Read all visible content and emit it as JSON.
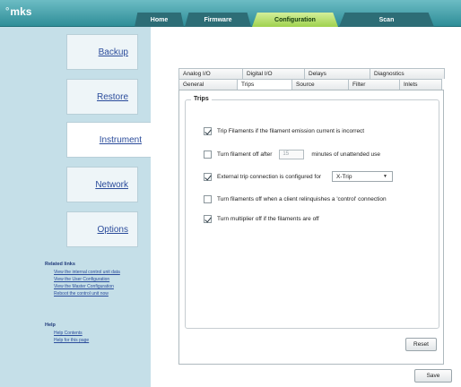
{
  "app": {
    "logo_text": "mks",
    "logo_mark": "°"
  },
  "topnav": {
    "tabs": [
      {
        "label": "Home"
      },
      {
        "label": "Firmware"
      },
      {
        "label": "Configuration"
      },
      {
        "label": "Scan"
      }
    ]
  },
  "sidebar": {
    "items": [
      {
        "label": "Backup"
      },
      {
        "label": "Restore"
      },
      {
        "label": "Instrument"
      },
      {
        "label": "Network"
      },
      {
        "label": "Options"
      }
    ],
    "related_title": "Related links",
    "related_links": [
      "View the internal control unit data",
      "View the User Configuration",
      "View the Master Configuration",
      "Reboot the control unit now"
    ],
    "help_title": "Help",
    "help_links": [
      "Help Contents",
      "Help for this page"
    ]
  },
  "config_tabs": {
    "row1": [
      "Analog I/O",
      "Digital I/O",
      "Delays",
      "Diagnostics"
    ],
    "row2": [
      "General",
      "Trips",
      "Source",
      "Filter",
      "Inlets"
    ]
  },
  "trips": {
    "legend": "Trips",
    "opt1": {
      "label": "Trip Filaments if the filament emission current is incorrect",
      "checked": true
    },
    "opt2": {
      "label_before": "Turn filament off after",
      "value": "15",
      "label_after": "minutes of unattended use",
      "checked": false
    },
    "opt3": {
      "label": "External trip connection is configured for",
      "selected": "X-Trip",
      "checked": true
    },
    "opt4": {
      "label": "Turn filaments off when a client relinquishes a 'control' connection",
      "checked": false
    },
    "opt5": {
      "label": "Turn multiplier off if the filaments are off",
      "checked": true
    }
  },
  "buttons": {
    "reset": "Reset",
    "save": "Save"
  },
  "colors": {
    "header": "#2f8e98",
    "active_tab": "#9fd14e",
    "sidebar": "#c5dfe8",
    "link": "#2b4c9b"
  }
}
